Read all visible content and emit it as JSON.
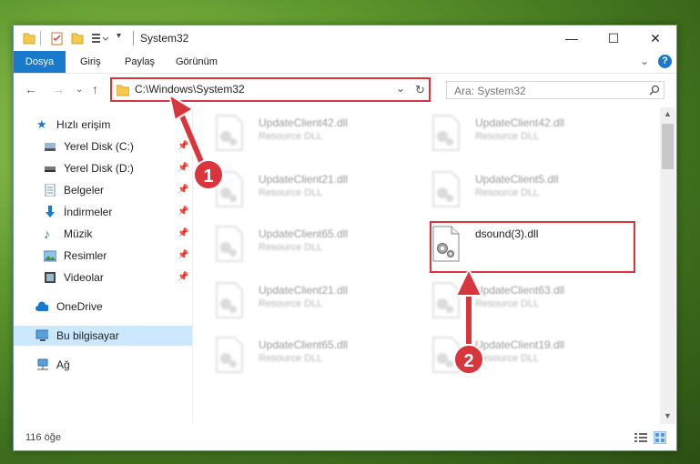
{
  "window": {
    "title": "System32",
    "controls": {
      "minimize": "—",
      "maximize": "☐",
      "close": "✕"
    }
  },
  "ribbon": {
    "tabs": [
      "Dosya",
      "Giriş",
      "Paylaş",
      "Görünüm"
    ]
  },
  "nav": {
    "address": "C:\\Windows\\System32",
    "search_placeholder": "Ara: System32"
  },
  "sidebar": {
    "items": [
      {
        "label": "Hızlı erişim",
        "icon": "star-icon",
        "pinned": false
      },
      {
        "label": "Yerel Disk (C:)",
        "icon": "drive-icon",
        "pinned": true
      },
      {
        "label": "Yerel Disk (D:)",
        "icon": "drive-icon",
        "pinned": true
      },
      {
        "label": "Belgeler",
        "icon": "documents-icon",
        "pinned": true
      },
      {
        "label": "İndirmeler",
        "icon": "download-icon",
        "pinned": true
      },
      {
        "label": "Müzik",
        "icon": "music-icon",
        "pinned": true
      },
      {
        "label": "Resimler",
        "icon": "pictures-icon",
        "pinned": true
      },
      {
        "label": "Videolar",
        "icon": "videos-icon",
        "pinned": true
      },
      {
        "label": "OneDrive",
        "icon": "cloud-icon",
        "pinned": false
      },
      {
        "label": "Bu bilgisayar",
        "icon": "computer-icon",
        "pinned": false
      },
      {
        "label": "Ağ",
        "icon": "network-icon",
        "pinned": false
      }
    ]
  },
  "files": [
    {
      "name": "UpdateClient42.dll",
      "type": "Resource DLL"
    },
    {
      "name": "UpdateClient42.dll",
      "type": "Resource DLL"
    },
    {
      "name": "UpdateClient21.dll",
      "type": "Resource DLL"
    },
    {
      "name": "UpdateClient5.dll",
      "type": "Resource DLL"
    },
    {
      "name": "UpdateClient65.dll",
      "type": "Resource DLL"
    },
    {
      "name": "dsound(3).dll",
      "type": ""
    },
    {
      "name": "UpdateClient21.dll",
      "type": "Resource DLL"
    },
    {
      "name": "UpdateClient63.dll",
      "type": "Resource DLL"
    },
    {
      "name": "UpdateClient65.dll",
      "type": "Resource DLL"
    },
    {
      "name": "UpdateClient19.dll",
      "type": "Resource DLL"
    }
  ],
  "status": {
    "count": "116 öğe"
  },
  "annotations": {
    "step1": "1",
    "step2": "2",
    "color": "#d9353d"
  }
}
